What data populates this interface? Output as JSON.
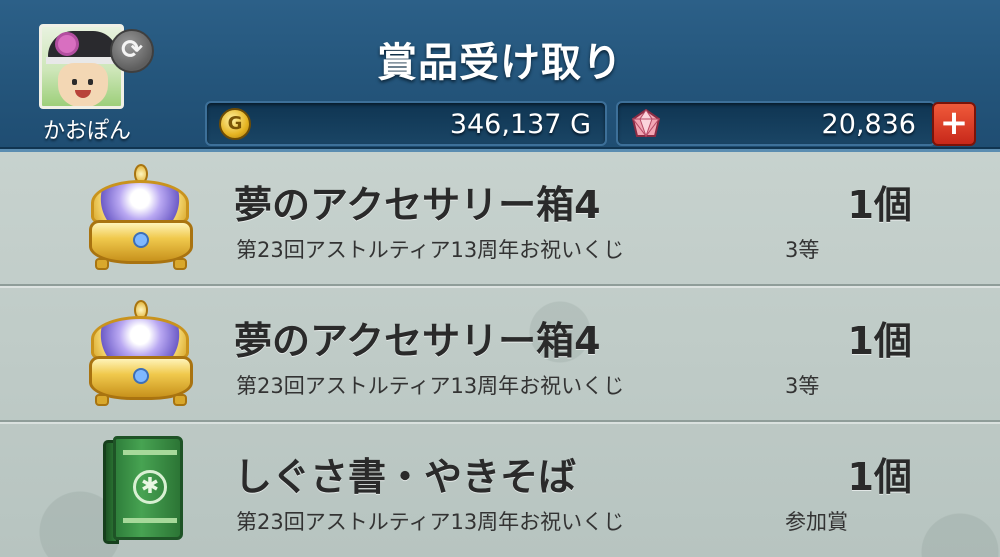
{
  "header": {
    "title": "賞品受け取り",
    "player_name": "かおぽん",
    "swap_icon": "refresh-icon",
    "gold": {
      "icon": "gold-coin-icon",
      "value": "346,137 G",
      "coin_glyph": "G"
    },
    "gems": {
      "icon": "gem-crystal-icon",
      "value": "20,836"
    },
    "plus_label": "+"
  },
  "prizes": [
    {
      "icon": "jewelry-box-icon",
      "name": "夢のアクセサリー箱4",
      "quantity": "1個",
      "source": "第23回アストルティア13周年お祝いくじ",
      "rank": "3等"
    },
    {
      "icon": "jewelry-box-icon",
      "name": "夢のアクセサリー箱4",
      "quantity": "1個",
      "source": "第23回アストルティア13周年お祝いくじ",
      "rank": "3等"
    },
    {
      "icon": "green-book-icon",
      "name": "しぐさ書・やきそば",
      "quantity": "1個",
      "source": "第23回アストルティア13周年お祝いくじ",
      "rank": "参加賞"
    }
  ],
  "colors": {
    "header_blue": "#24557b",
    "list_bg": "#c7d2ce",
    "plus_red": "#d83a25",
    "text_dark": "#2a2a2a"
  }
}
